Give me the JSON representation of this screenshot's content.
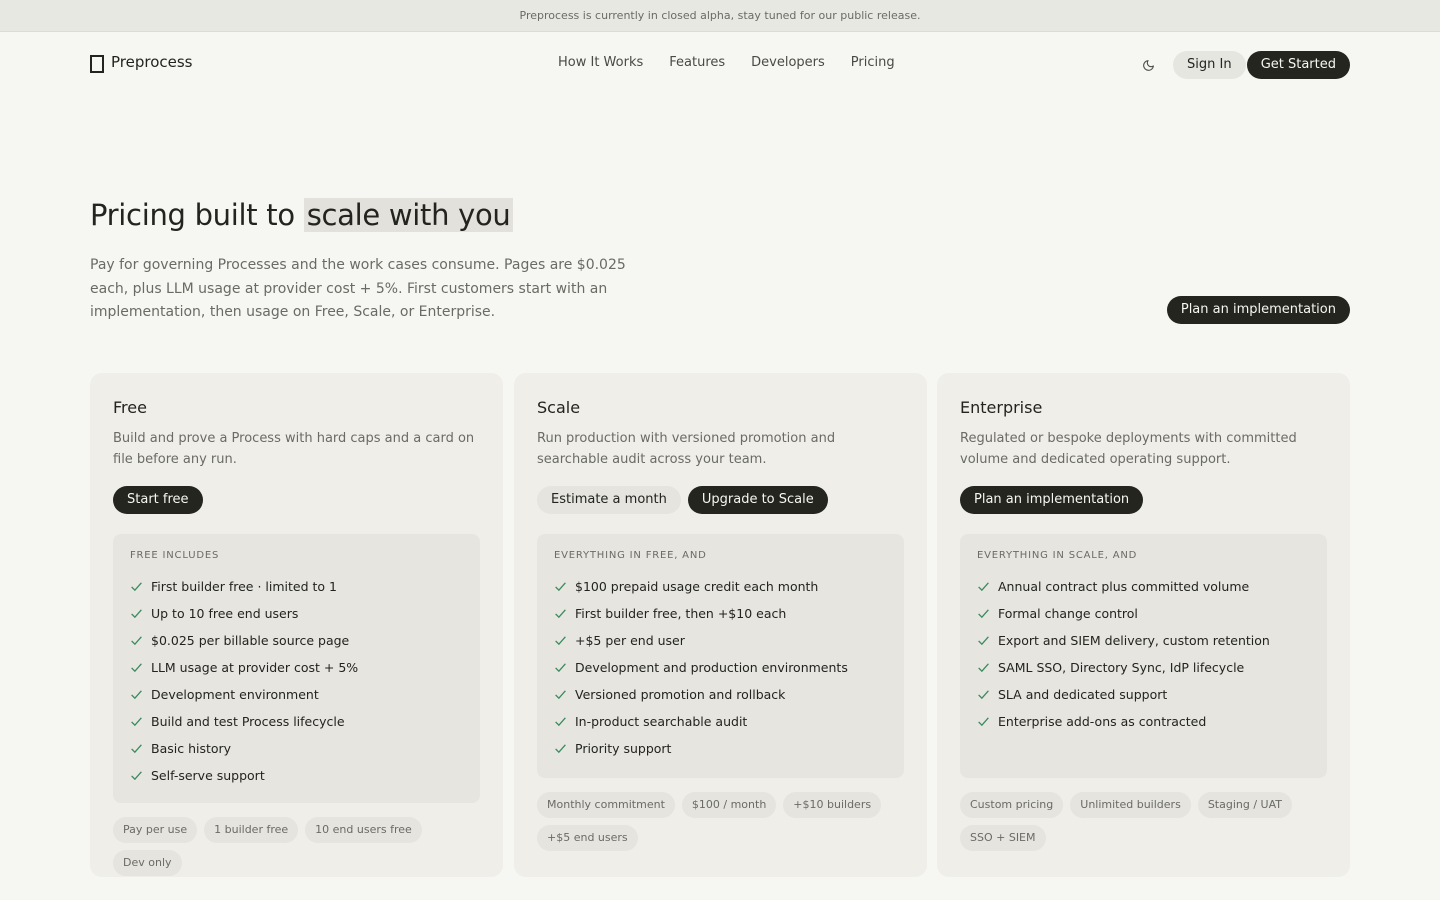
{
  "banner": {
    "text": "Preprocess is currently in closed alpha, stay tuned for our public release."
  },
  "nav": {
    "brand": "Preprocess",
    "links": [
      "How It Works",
      "Features",
      "Developers",
      "Pricing"
    ],
    "theme_icon": "moon-icon",
    "sign_in": "Sign In",
    "get_started": "Get Started"
  },
  "hero": {
    "title_prefix": "Pricing built to",
    "title_highlight": "scale with you",
    "subtitle": "Pay for governing Processes and the work cases consume. Pages are $0.025 each, plus LLM usage at provider cost + 5%. First customers start with an implementation, then usage on Free, Scale, or Enterprise.",
    "cta": "Plan an implementation"
  },
  "plans": [
    {
      "name": "Free",
      "description": "Build and prove a Process with hard caps and a card on file before any run.",
      "primary": "Start free",
      "includes_label": "FREE INCLUDES",
      "features": [
        "First builder free · limited to 1",
        "Up to 10 free end users",
        "$0.025 per billable source page",
        "LLM usage at provider cost + 5%",
        "Development environment",
        "Build and test Process lifecycle",
        "Basic history",
        "Self-serve support"
      ],
      "tags": [
        "Pay per use",
        "1 builder free",
        "10 end users free",
        "Dev only"
      ]
    },
    {
      "name": "Scale",
      "description": "Run production with versioned promotion and searchable audit across your team.",
      "secondary": "Estimate a month",
      "primary": "Upgrade to Scale",
      "includes_label": "EVERYTHING IN FREE, AND",
      "features": [
        "$100 prepaid usage credit each month",
        "First builder free, then +$10 each",
        "+$5 per end user",
        "Development and production environments",
        "Versioned promotion and rollback",
        "In-product searchable audit",
        "Priority support"
      ],
      "tags": [
        "Monthly commitment",
        "$100 / month",
        "+$10 builders",
        "+$5 end users"
      ]
    },
    {
      "name": "Enterprise",
      "description": "Regulated or bespoke deployments with committed volume and dedicated operating support.",
      "primary": "Plan an implementation",
      "includes_label": "EVERYTHING IN SCALE, AND",
      "features": [
        "Annual contract plus committed volume",
        "Formal change control",
        "Export and SIEM delivery, custom retention",
        "SAML SSO, Directory Sync, IdP lifecycle",
        "SLA and dedicated support",
        "Enterprise add-ons as contracted"
      ],
      "tags": [
        "Custom pricing",
        "Unlimited builders",
        "Staging / UAT",
        "SSO + SIEM"
      ]
    }
  ],
  "colors": {
    "accent_dark": "#25251f",
    "check_green": "#3a8a5c",
    "background": "#f6f6f2"
  }
}
